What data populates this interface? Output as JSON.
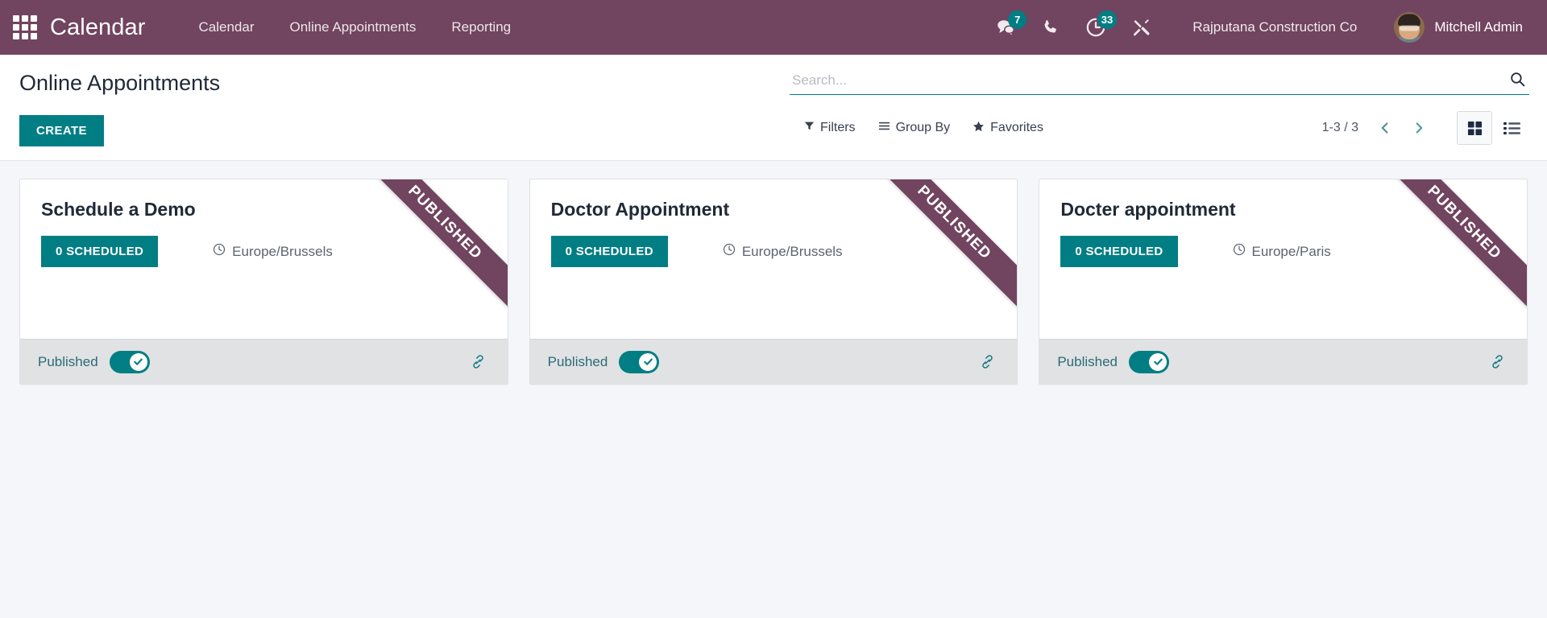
{
  "navbar": {
    "apps_icon": "apps-grid-icon",
    "brand": "Calendar",
    "menu": [
      {
        "label": "Calendar"
      },
      {
        "label": "Online Appointments"
      },
      {
        "label": "Reporting"
      }
    ],
    "systray": [
      {
        "icon": "messages-icon",
        "badge": "7"
      },
      {
        "icon": "phone-icon",
        "badge": ""
      },
      {
        "icon": "activities-clock-icon",
        "badge": "33"
      },
      {
        "icon": "tools-wrench-icon",
        "badge": ""
      }
    ],
    "company": "Rajputana Construction Co",
    "user": "Mitchell Admin",
    "avatar_icon": "user-avatar"
  },
  "control_panel": {
    "title": "Online Appointments",
    "create_label": "CREATE",
    "search": {
      "placeholder": "Search...",
      "value": "",
      "icon": "search-icon"
    },
    "filters": [
      {
        "label": "Filters",
        "icon": "filter-funnel-icon"
      },
      {
        "label": "Group By",
        "icon": "group-by-lines-icon"
      },
      {
        "label": "Favorites",
        "icon": "favorites-star-icon"
      }
    ],
    "pager": {
      "count": "1-3 / 3",
      "prev_icon": "chevron-left-icon",
      "next_icon": "chevron-right-icon"
    },
    "views": [
      {
        "name": "kanban",
        "icon": "kanban-view-icon",
        "active": true
      },
      {
        "name": "list",
        "icon": "list-view-icon",
        "active": false
      }
    ]
  },
  "kanban": {
    "ribbon_label": "PUBLISHED",
    "cards": [
      {
        "title": "Schedule a Demo",
        "scheduled": "0 SCHEDULED",
        "timezone": "Europe/Brussels",
        "timezone_icon": "clock-icon",
        "footer_label": "Published",
        "toggle_on": true,
        "link_icon": "chain-link-icon"
      },
      {
        "title": "Doctor Appointment",
        "scheduled": "0 SCHEDULED",
        "timezone": "Europe/Brussels",
        "timezone_icon": "clock-icon",
        "footer_label": "Published",
        "toggle_on": true,
        "link_icon": "chain-link-icon"
      },
      {
        "title": "Docter appointment",
        "scheduled": "0 SCHEDULED",
        "timezone": "Europe/Paris",
        "timezone_icon": "clock-icon",
        "footer_label": "Published",
        "toggle_on": true,
        "link_icon": "chain-link-icon"
      }
    ]
  },
  "colors": {
    "navbar_purple": "#71445F",
    "accent_teal": "#017E84",
    "page_background": "#F4F6F9",
    "card_footer": "#E0E2E4"
  }
}
